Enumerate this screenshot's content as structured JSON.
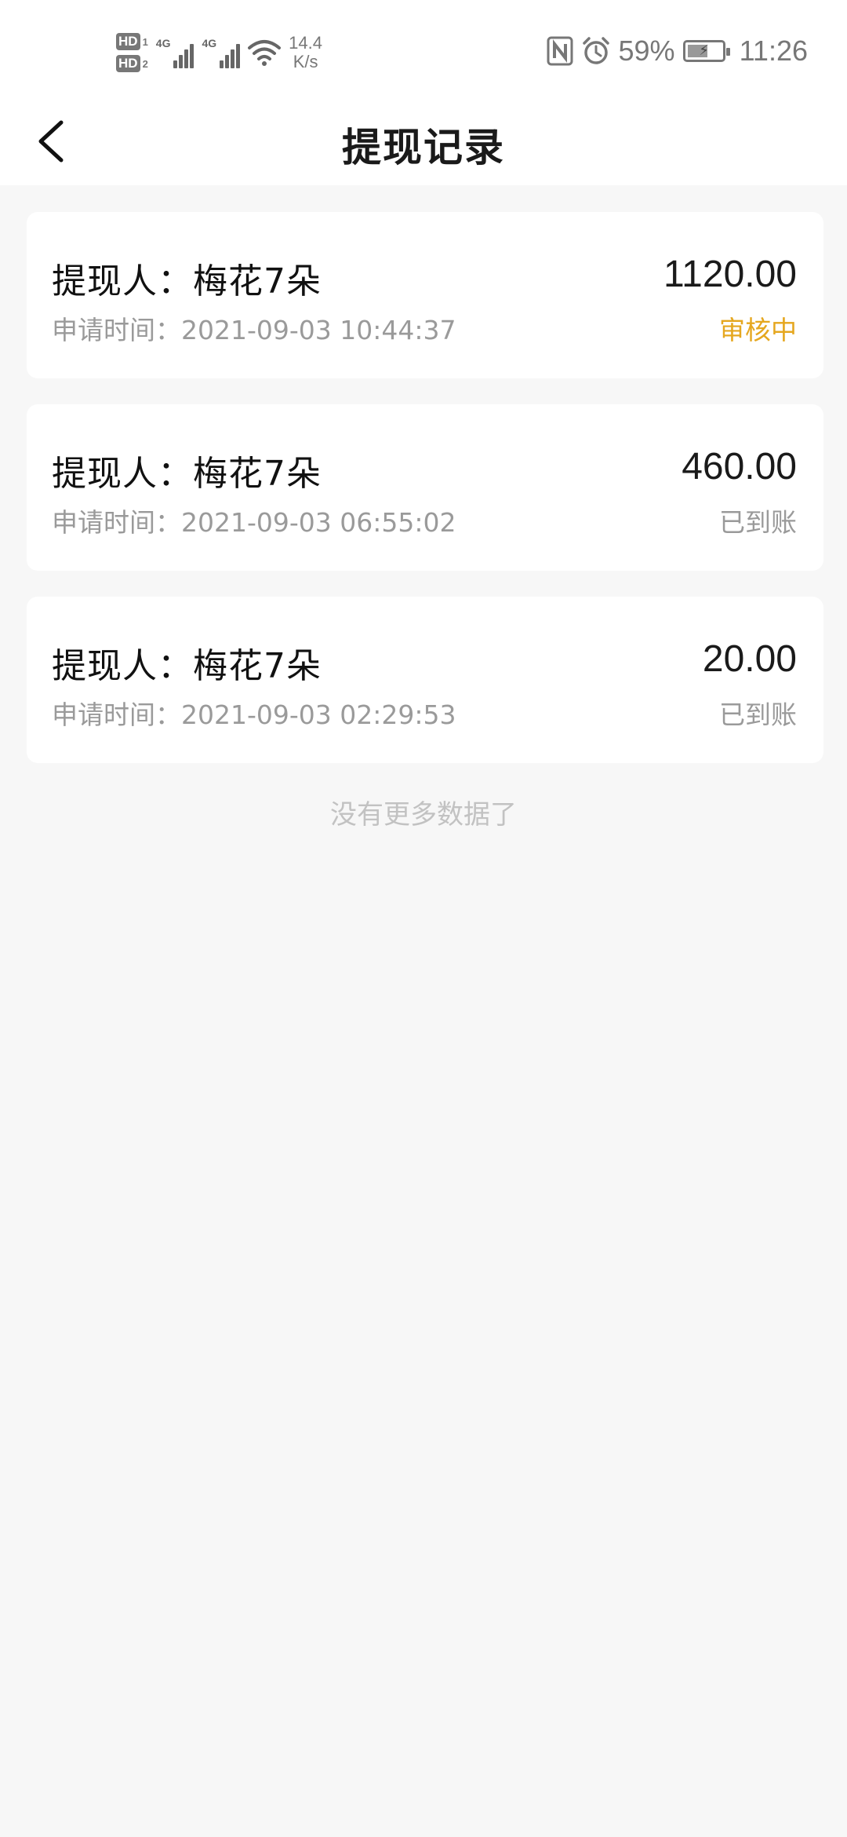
{
  "status_bar": {
    "sim1": "HD",
    "sim1_index": "1",
    "sim2": "HD",
    "sim2_index": "2",
    "network_type_1": "4G",
    "network_type_2": "4G",
    "net_speed_value": "14.4",
    "net_speed_unit": "K/s",
    "battery_percent": "59%",
    "time": "11:26",
    "icons": [
      "hd-icon",
      "signal-icon",
      "wifi-icon",
      "nfc-icon",
      "alarm-icon",
      "battery-icon"
    ]
  },
  "navbar": {
    "back_icon": "chevron-left-icon",
    "title": "提现记录"
  },
  "records": [
    {
      "payee": "提现人：梅花7朵",
      "time": "申请时间：2021-09-03 10:44:37",
      "amount": "1120.00",
      "status": "审核中",
      "status_type": "pending"
    },
    {
      "payee": "提现人：梅花7朵",
      "time": "申请时间：2021-09-03 06:55:02",
      "amount": "460.00",
      "status": "已到账",
      "status_type": "done"
    },
    {
      "payee": "提现人：梅花7朵",
      "time": "申请时间：2021-09-03 02:29:53",
      "amount": "20.00",
      "status": "已到账",
      "status_type": "done"
    }
  ],
  "footer": {
    "no_more": "没有更多数据了"
  },
  "colors": {
    "pending": "#e5a71f",
    "muted": "#9a9a9a",
    "background": "#f7f7f7"
  }
}
